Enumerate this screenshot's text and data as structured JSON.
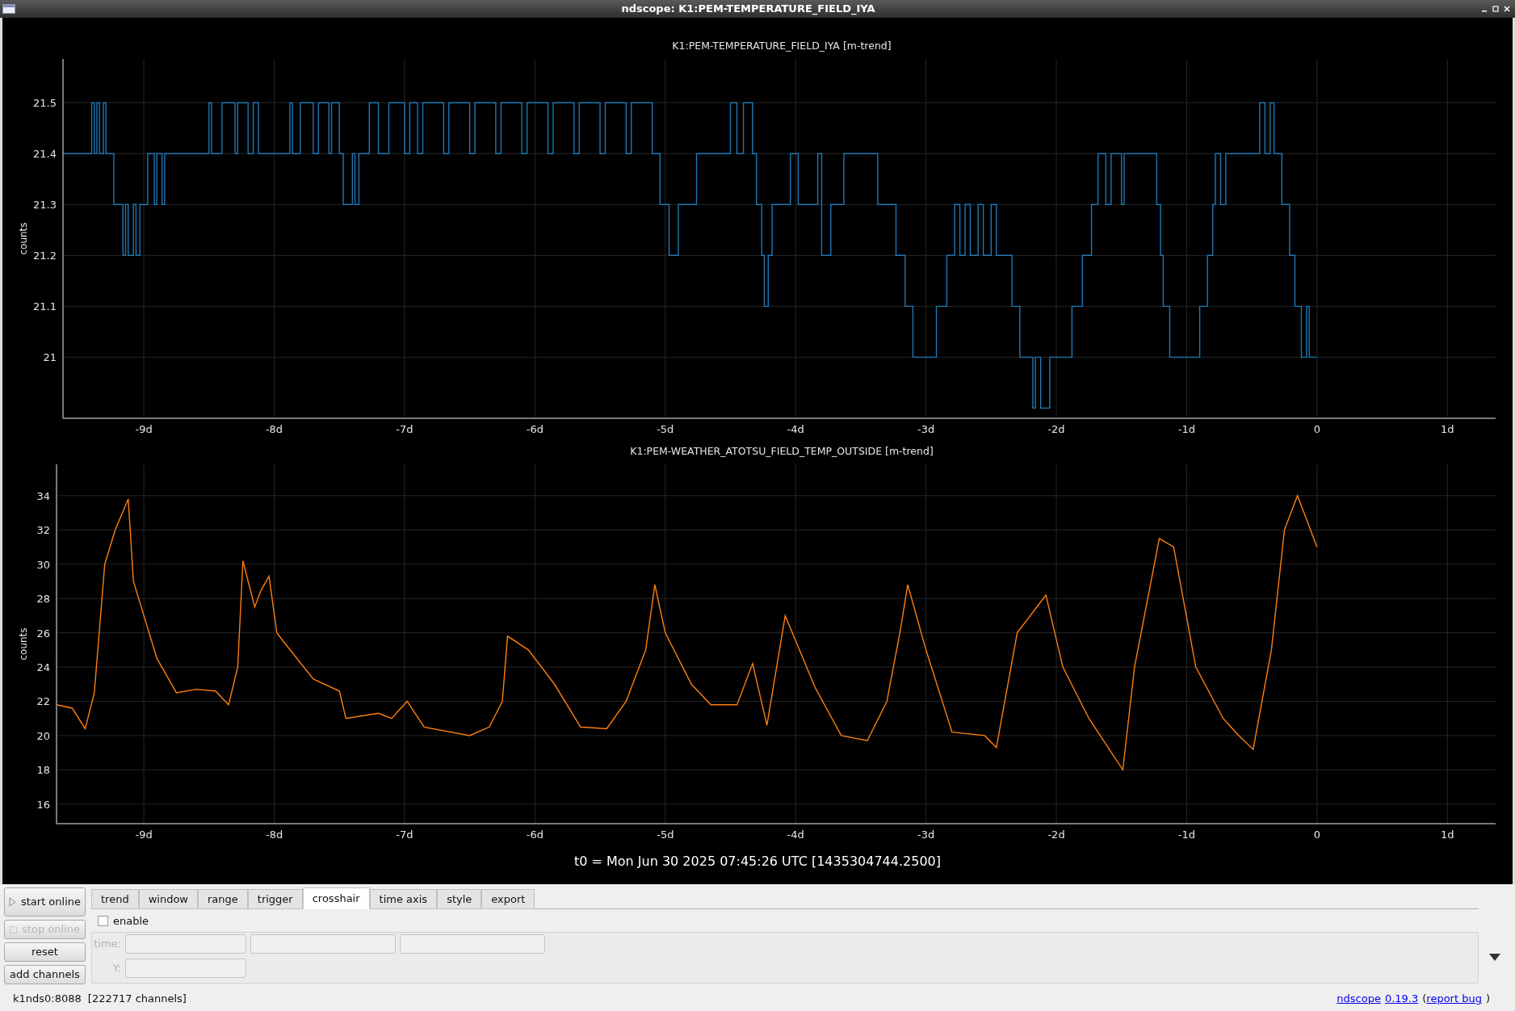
{
  "window": {
    "title": "ndscope: K1:PEM-TEMPERATURE_FIELD_IYA"
  },
  "plots": [
    {
      "chart_data": {
        "type": "line",
        "title": "K1:PEM-TEMPERATURE_FIELD_IYA [m-trend]",
        "ylabel": "counts",
        "grid": true,
        "xlim": [
          -9.62,
          1.37
        ],
        "ylim": [
          20.88,
          21.586
        ],
        "xticks": [
          {
            "value": -9,
            "label": "-9d"
          },
          {
            "value": -8,
            "label": "-8d"
          },
          {
            "value": -7,
            "label": "-7d"
          },
          {
            "value": -6,
            "label": "-6d"
          },
          {
            "value": -5,
            "label": "-5d"
          },
          {
            "value": -4,
            "label": "-4d"
          },
          {
            "value": -3,
            "label": "-3d"
          },
          {
            "value": -2,
            "label": "-2d"
          },
          {
            "value": -1,
            "label": "-1d"
          },
          {
            "value": 0,
            "label": "0"
          },
          {
            "value": 1,
            "label": "1d"
          }
        ],
        "yticks": [
          21,
          21.1,
          21.2,
          21.3,
          21.4,
          21.5
        ],
        "x": [
          -9.62,
          -9.4,
          -9.4,
          -9.38,
          -9.38,
          -9.36,
          -9.36,
          -9.34,
          -9.34,
          -9.31,
          -9.31,
          -9.29,
          -9.29,
          -9.23,
          -9.23,
          -9.16,
          -9.16,
          -9.14,
          -9.14,
          -9.12,
          -9.12,
          -9.08,
          -9.08,
          -9.06,
          -9.06,
          -9.03,
          -9.03,
          -8.97,
          -8.97,
          -8.92,
          -8.92,
          -8.9,
          -8.9,
          -8.86,
          -8.86,
          -8.84,
          -8.84,
          -8.5,
          -8.5,
          -8.48,
          -8.48,
          -8.4,
          -8.4,
          -8.3,
          -8.3,
          -8.28,
          -8.28,
          -8.2,
          -8.2,
          -8.16,
          -8.16,
          -8.12,
          -8.12,
          -7.88,
          -7.88,
          -7.86,
          -7.86,
          -7.8,
          -7.8,
          -7.7,
          -7.7,
          -7.66,
          -7.66,
          -7.58,
          -7.58,
          -7.56,
          -7.56,
          -7.5,
          -7.5,
          -7.47,
          -7.47,
          -7.4,
          -7.4,
          -7.38,
          -7.38,
          -7.35,
          -7.35,
          -7.27,
          -7.27,
          -7.2,
          -7.2,
          -7.12,
          -7.12,
          -7.0,
          -7.0,
          -6.96,
          -6.96,
          -6.9,
          -6.9,
          -6.86,
          -6.86,
          -6.7,
          -6.7,
          -6.66,
          -6.66,
          -6.5,
          -6.5,
          -6.46,
          -6.46,
          -6.3,
          -6.3,
          -6.26,
          -6.26,
          -6.1,
          -6.1,
          -6.06,
          -6.06,
          -5.9,
          -5.9,
          -5.86,
          -5.86,
          -5.7,
          -5.7,
          -5.66,
          -5.66,
          -5.5,
          -5.5,
          -5.46,
          -5.46,
          -5.3,
          -5.3,
          -5.26,
          -5.26,
          -5.1,
          -5.1,
          -5.04,
          -5.04,
          -4.97,
          -4.97,
          -4.9,
          -4.9,
          -4.76,
          -4.76,
          -4.5,
          -4.5,
          -4.45,
          -4.45,
          -4.4,
          -4.4,
          -4.33,
          -4.33,
          -4.3,
          -4.3,
          -4.26,
          -4.26,
          -4.24,
          -4.24,
          -4.21,
          -4.21,
          -4.18,
          -4.18,
          -4.04,
          -4.04,
          -3.98,
          -3.98,
          -3.83,
          -3.83,
          -3.8,
          -3.8,
          -3.73,
          -3.73,
          -3.63,
          -3.63,
          -3.37,
          -3.37,
          -3.23,
          -3.23,
          -3.16,
          -3.16,
          -3.1,
          -3.1,
          -2.92,
          -2.92,
          -2.84,
          -2.84,
          -2.78,
          -2.78,
          -2.74,
          -2.74,
          -2.7,
          -2.7,
          -2.66,
          -2.66,
          -2.6,
          -2.6,
          -2.56,
          -2.56,
          -2.5,
          -2.5,
          -2.46,
          -2.46,
          -2.34,
          -2.34,
          -2.28,
          -2.28,
          -2.18,
          -2.18,
          -2.16,
          -2.16,
          -2.12,
          -2.12,
          -2.05,
          -2.05,
          -1.88,
          -1.88,
          -1.8,
          -1.8,
          -1.73,
          -1.73,
          -1.68,
          -1.68,
          -1.62,
          -1.62,
          -1.58,
          -1.58,
          -1.5,
          -1.5,
          -1.48,
          -1.48,
          -1.23,
          -1.23,
          -1.2,
          -1.2,
          -1.18,
          -1.18,
          -1.13,
          -1.13,
          -0.9,
          -0.9,
          -0.84,
          -0.84,
          -0.8,
          -0.8,
          -0.78,
          -0.78,
          -0.74,
          -0.74,
          -0.7,
          -0.7,
          -0.44,
          -0.44,
          -0.4,
          -0.4,
          -0.36,
          -0.36,
          -0.33,
          -0.33,
          -0.27,
          -0.27,
          -0.21,
          -0.21,
          -0.17,
          -0.17,
          -0.12,
          -0.12,
          -0.08,
          -0.08,
          -0.06,
          -0.06,
          0
        ],
        "series": [
          {
            "color": "#1f77b4",
            "values": [
              21.4,
              21.4,
              21.5,
              21.5,
              21.4,
              21.4,
              21.5,
              21.5,
              21.4,
              21.4,
              21.5,
              21.5,
              21.4,
              21.4,
              21.3,
              21.3,
              21.2,
              21.2,
              21.3,
              21.3,
              21.2,
              21.2,
              21.3,
              21.3,
              21.2,
              21.2,
              21.3,
              21.3,
              21.4,
              21.4,
              21.3,
              21.3,
              21.4,
              21.4,
              21.3,
              21.3,
              21.4,
              21.4,
              21.5,
              21.5,
              21.4,
              21.4,
              21.5,
              21.5,
              21.4,
              21.4,
              21.5,
              21.5,
              21.4,
              21.4,
              21.5,
              21.5,
              21.4,
              21.4,
              21.5,
              21.5,
              21.4,
              21.4,
              21.5,
              21.5,
              21.4,
              21.4,
              21.5,
              21.5,
              21.4,
              21.4,
              21.5,
              21.5,
              21.4,
              21.4,
              21.3,
              21.3,
              21.4,
              21.4,
              21.3,
              21.3,
              21.4,
              21.4,
              21.5,
              21.5,
              21.4,
              21.4,
              21.5,
              21.5,
              21.4,
              21.4,
              21.5,
              21.5,
              21.4,
              21.4,
              21.5,
              21.5,
              21.4,
              21.4,
              21.5,
              21.5,
              21.4,
              21.4,
              21.5,
              21.5,
              21.4,
              21.4,
              21.5,
              21.5,
              21.4,
              21.4,
              21.5,
              21.5,
              21.4,
              21.4,
              21.5,
              21.5,
              21.4,
              21.4,
              21.5,
              21.5,
              21.4,
              21.4,
              21.5,
              21.5,
              21.4,
              21.4,
              21.5,
              21.5,
              21.4,
              21.4,
              21.3,
              21.3,
              21.2,
              21.2,
              21.3,
              21.3,
              21.4,
              21.4,
              21.5,
              21.5,
              21.4,
              21.4,
              21.5,
              21.5,
              21.4,
              21.4,
              21.3,
              21.3,
              21.2,
              21.2,
              21.1,
              21.1,
              21.2,
              21.2,
              21.3,
              21.3,
              21.4,
              21.4,
              21.3,
              21.3,
              21.4,
              21.4,
              21.2,
              21.2,
              21.3,
              21.3,
              21.4,
              21.4,
              21.3,
              21.3,
              21.2,
              21.2,
              21.1,
              21.1,
              21.0,
              21.0,
              21.1,
              21.1,
              21.2,
              21.2,
              21.3,
              21.3,
              21.2,
              21.2,
              21.3,
              21.3,
              21.2,
              21.2,
              21.3,
              21.3,
              21.2,
              21.2,
              21.3,
              21.3,
              21.2,
              21.2,
              21.1,
              21.1,
              21.0,
              21.0,
              20.9,
              20.9,
              21.0,
              21.0,
              20.9,
              20.9,
              21.0,
              21.0,
              21.1,
              21.1,
              21.2,
              21.2,
              21.3,
              21.3,
              21.4,
              21.4,
              21.3,
              21.3,
              21.4,
              21.4,
              21.3,
              21.3,
              21.4,
              21.4,
              21.3,
              21.3,
              21.2,
              21.2,
              21.1,
              21.1,
              21.0,
              21.0,
              21.1,
              21.1,
              21.2,
              21.2,
              21.3,
              21.3,
              21.4,
              21.4,
              21.3,
              21.3,
              21.4,
              21.4,
              21.5,
              21.5,
              21.4,
              21.4,
              21.5,
              21.5,
              21.4,
              21.4,
              21.3,
              21.3,
              21.2,
              21.2,
              21.1,
              21.1,
              21.0,
              21.0,
              21.1,
              21.1,
              21.0,
              21.0
            ]
          }
        ]
      }
    },
    {
      "chart_data": {
        "type": "line",
        "title": "K1:PEM-WEATHER_ATOTSU_FIELD_TEMP_OUTSIDE [m-trend]",
        "ylabel": "counts",
        "grid": true,
        "xlim": [
          -9.67,
          1.37
        ],
        "ylim": [
          14.86,
          35.83
        ],
        "xticks": [
          {
            "value": -9,
            "label": "-9d"
          },
          {
            "value": -8,
            "label": "-8d"
          },
          {
            "value": -7,
            "label": "-7d"
          },
          {
            "value": -6,
            "label": "-6d"
          },
          {
            "value": -5,
            "label": "-5d"
          },
          {
            "value": -4,
            "label": "-4d"
          },
          {
            "value": -3,
            "label": "-3d"
          },
          {
            "value": -2,
            "label": "-2d"
          },
          {
            "value": -1,
            "label": "-1d"
          },
          {
            "value": 0,
            "label": "0"
          },
          {
            "value": 1,
            "label": "1d"
          }
        ],
        "yticks": [
          16,
          18,
          20,
          22,
          24,
          26,
          28,
          30,
          32,
          34
        ],
        "x": [
          -9.67,
          -9.55,
          -9.45,
          -9.38,
          -9.3,
          -9.22,
          -9.12,
          -9.08,
          -9.0,
          -8.9,
          -8.75,
          -8.6,
          -8.45,
          -8.35,
          -8.28,
          -8.24,
          -8.15,
          -8.1,
          -8.04,
          -7.98,
          -7.93,
          -7.7,
          -7.5,
          -7.45,
          -7.2,
          -7.1,
          -6.98,
          -6.85,
          -6.5,
          -6.35,
          -6.25,
          -6.21,
          -6.05,
          -5.85,
          -5.65,
          -5.45,
          -5.3,
          -5.15,
          -5.08,
          -5.0,
          -4.8,
          -4.65,
          -4.45,
          -4.33,
          -4.22,
          -4.08,
          -3.85,
          -3.65,
          -3.45,
          -3.3,
          -3.2,
          -3.14,
          -3.0,
          -2.8,
          -2.55,
          -2.46,
          -2.3,
          -2.15,
          -2.08,
          -1.95,
          -1.75,
          -1.49,
          -1.4,
          -1.21,
          -1.1,
          -0.93,
          -0.72,
          -0.6,
          -0.49,
          -0.35,
          -0.25,
          -0.15,
          -0.05,
          0
        ],
        "series": [
          {
            "color": "#ff7f0e",
            "values": [
              21.8,
              21.6,
              20.4,
              22.5,
              30,
              32,
              33.8,
              29,
              27,
              24.5,
              22.5,
              22.7,
              22.6,
              21.8,
              24,
              30.2,
              27.5,
              28.5,
              29.3,
              26,
              25.5,
              23.3,
              22.6,
              21,
              21.3,
              21,
              22,
              20.5,
              20,
              20.5,
              22,
              25.8,
              25,
              23,
              20.5,
              20.4,
              22,
              25,
              28.8,
              26,
              23,
              21.8,
              21.8,
              24.2,
              20.6,
              27,
              22.8,
              20,
              19.7,
              22,
              26,
              28.8,
              25,
              20.2,
              20,
              19.3,
              26,
              27.5,
              28.2,
              24,
              21,
              18,
              24,
              31.5,
              31,
              24,
              21,
              20,
              19.2,
              25,
              32,
              34,
              32,
              31
            ]
          }
        ]
      }
    }
  ],
  "t0_label": "t0 = Mon Jun 30 2025 07:45:26 UTC [1435304744.2500]",
  "buttons": [
    {
      "label": "start online",
      "kind": "start",
      "disabled": false
    },
    {
      "label": "stop online",
      "kind": "stop",
      "disabled": true
    },
    {
      "label": "reset",
      "kind": "plain",
      "disabled": false
    },
    {
      "label": "add channels",
      "kind": "plain",
      "disabled": false
    }
  ],
  "tabs": [
    {
      "label": "trend",
      "selected": false
    },
    {
      "label": "window",
      "selected": false
    },
    {
      "label": "range",
      "selected": false
    },
    {
      "label": "trigger",
      "selected": false
    },
    {
      "label": "crosshair",
      "selected": true
    },
    {
      "label": "time axis",
      "selected": false
    },
    {
      "label": "style",
      "selected": false
    },
    {
      "label": "export",
      "selected": false
    }
  ],
  "crosshair": {
    "enable": {
      "label": "enable",
      "checked": false
    },
    "disabled": true,
    "time_label": "time:",
    "y_label": "Y:"
  },
  "status_bar": {
    "server": "k1nds0:8088",
    "channels": "[222717 channels]",
    "about": [
      {
        "text": "ndscope",
        "link": true
      },
      {
        "text": "0.19.3",
        "link": true
      },
      {
        "text": "(",
        "link": false
      },
      {
        "text": "report bug",
        "link": true
      },
      {
        "text": ")",
        "link": false
      }
    ]
  }
}
